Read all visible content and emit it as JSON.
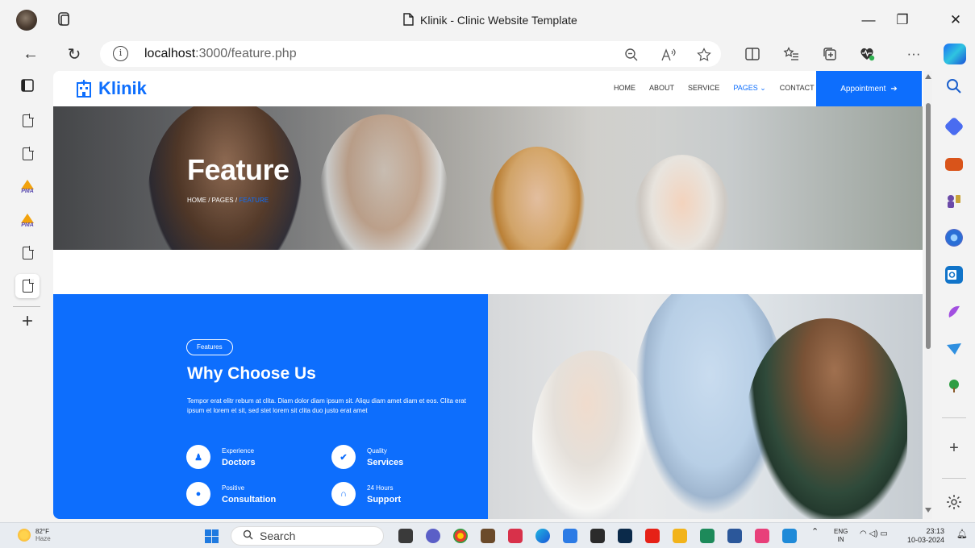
{
  "window": {
    "title": "Klinik - Clinic Website Template",
    "minimize_glyph": "—",
    "restore_glyph": "❐",
    "close_glyph": "✕"
  },
  "toolbar": {
    "url_host": "localhost",
    "url_path": ":3000/feature.php",
    "info_glyph": "i",
    "more_glyph": "···"
  },
  "site": {
    "brand": "Klinik",
    "nav": [
      "HOME",
      "ABOUT",
      "SERVICE",
      "PAGES",
      "CONTACT"
    ],
    "appointment_label": "Appointment",
    "hero_title": "Feature",
    "breadcrumb": [
      "HOME",
      "PAGES",
      "FEATURE"
    ],
    "badge": "Features",
    "section_title": "Why Choose Us",
    "section_text": "Tempor erat elitr rebum at clita. Diam dolor diam ipsum sit. Aliqu diam amet diam et eos. Clita erat ipsum et lorem et sit, sed stet lorem sit clita duo justo erat amet",
    "features": [
      {
        "small": "Experience",
        "big": "Doctors",
        "icon": "user-md-icon"
      },
      {
        "small": "Quality",
        "big": "Services",
        "icon": "check-icon"
      },
      {
        "small": "Positive",
        "big": "Consultation",
        "icon": "comment-icon"
      },
      {
        "small": "24 Hours",
        "big": "Support",
        "icon": "headphones-icon"
      }
    ],
    "accent_color": "#0d6efd"
  },
  "taskbar": {
    "temp": "82°F",
    "weather": "Haze",
    "search": "Search",
    "lang": "ENG",
    "region": "IN",
    "time": "23:13",
    "date": "10-03-2024"
  }
}
